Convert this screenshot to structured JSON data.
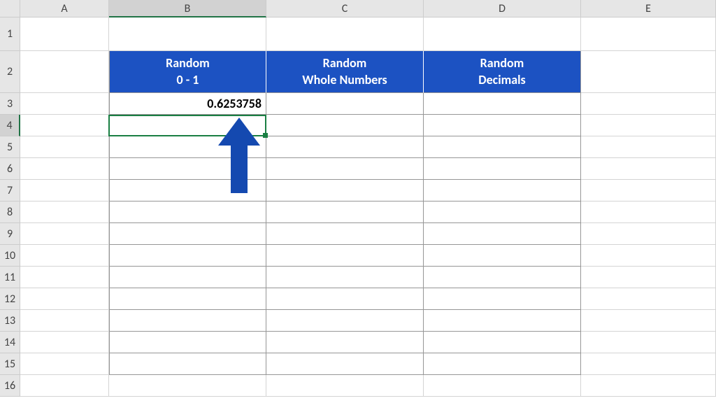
{
  "columns": [
    "A",
    "B",
    "C",
    "D",
    "E"
  ],
  "rows": [
    "1",
    "2",
    "3",
    "4",
    "5",
    "6",
    "7",
    "8",
    "9",
    "10",
    "11",
    "12",
    "13",
    "14",
    "15",
    "16"
  ],
  "active_column": "B",
  "active_row": "4",
  "selected_cell": "B4",
  "headers": {
    "b2": "Random\n0 - 1",
    "c2": "Random\nWhole Numbers",
    "d2": "Random\nDecimals"
  },
  "values": {
    "b3": "0.6253758"
  },
  "colors": {
    "header_bg": "#1c52c2",
    "selection": "#1a7f43",
    "arrow": "#1449b0"
  }
}
